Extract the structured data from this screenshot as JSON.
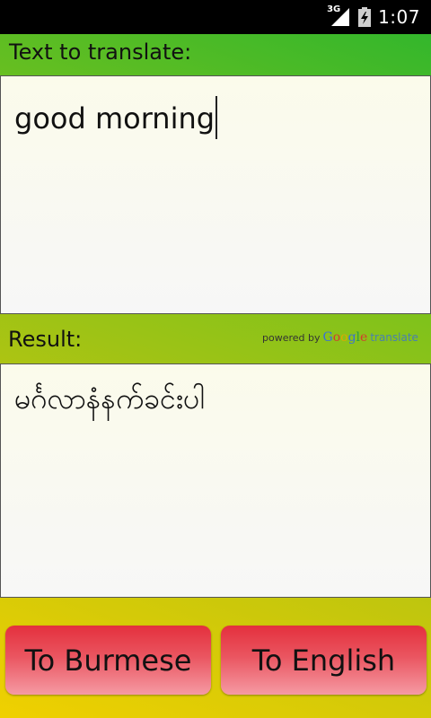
{
  "status_bar": {
    "network": "3G",
    "time": "1:07"
  },
  "source": {
    "label": "Text to translate:",
    "text": "good morning"
  },
  "result": {
    "label": "Result:",
    "text": "မင်္ဂလာနံနက်ခင်းပါ"
  },
  "attribution": {
    "powered_by": "powered by",
    "google_g1": "G",
    "google_o1": "o",
    "google_o2": "o",
    "google_g2": "g",
    "google_l": "l",
    "google_e": "e",
    "translate": "translate"
  },
  "buttons": {
    "to_burmese": "To Burmese",
    "to_english": "To English"
  },
  "colors": {
    "button_red": "#e4303d",
    "background_green": "#2ab52e",
    "background_yellow": "#f0d000"
  }
}
